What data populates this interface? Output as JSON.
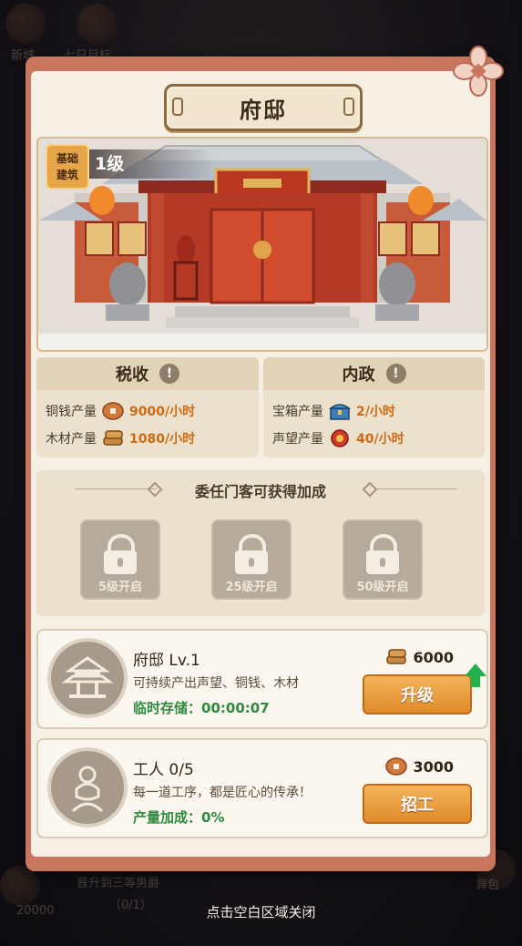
{
  "panel": {
    "title": "府邸"
  },
  "building": {
    "tier_badge_line1": "基础",
    "tier_badge_line2": "建筑",
    "level": "1级"
  },
  "tax": {
    "header": "税收",
    "rows": [
      {
        "label": "铜钱产量",
        "value": "9000/小时",
        "icon": "copper-coin-icon"
      },
      {
        "label": "木材产量",
        "value": "1080/小时",
        "icon": "wood-icon"
      }
    ]
  },
  "domestic": {
    "header": "内政",
    "rows": [
      {
        "label": "宝箱产量",
        "value": "2/小时",
        "icon": "treasure-chest-icon"
      },
      {
        "label": "声望产量",
        "value": "40/小时",
        "icon": "prestige-icon"
      }
    ]
  },
  "retainers": {
    "title": "委任门客可获得加成",
    "slots": [
      {
        "label": "5级开启"
      },
      {
        "label": "25级开启"
      },
      {
        "label": "50级开启"
      }
    ]
  },
  "mansion_card": {
    "name": "府邸 Lv.1",
    "desc": "可持续产出声望、铜钱、木材",
    "storage_label": "临时存储：",
    "storage_time": "00:00:07",
    "cost": "6000",
    "button": "升级"
  },
  "worker_card": {
    "name": "工人 0/5",
    "desc": "每一道工序，都是匠心的传承！",
    "bonus_label": "产量加成：",
    "bonus_value": "0%",
    "cost": "3000",
    "button": "招工"
  },
  "background": {
    "items": [
      "新城",
      "七日目标",
      "晋升到三等男爵",
      "（0/1）",
      "20000",
      "背包"
    ]
  },
  "close_hint": "点击空白区域关闭",
  "colors": {
    "accent": "#e08a2b",
    "panel_frame": "#c9765f",
    "value_orange": "#d06a12",
    "green": "#2e8a3e"
  }
}
